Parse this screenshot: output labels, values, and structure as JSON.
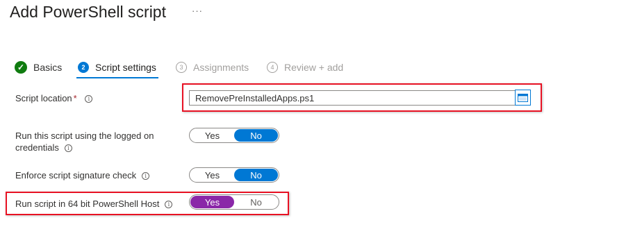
{
  "page": {
    "title": "Add PowerShell script",
    "more_label": "···"
  },
  "wizard": {
    "steps": [
      {
        "label": "Basics",
        "number": "✓",
        "state": "done"
      },
      {
        "label": "Script settings",
        "number": "2",
        "state": "active"
      },
      {
        "label": "Assignments",
        "number": "3",
        "state": "pending"
      },
      {
        "label": "Review + add",
        "number": "4",
        "state": "pending"
      }
    ]
  },
  "form": {
    "script_location": {
      "label": "Script location",
      "required_mark": "*",
      "value": "RemovePreInstalledApps.ps1"
    },
    "logged_on_credentials": {
      "label_line1": "Run this script using the logged on",
      "label_line2": "credentials",
      "yes": "Yes",
      "no": "No",
      "selected": "No"
    },
    "signature_check": {
      "label": "Enforce script signature check",
      "yes": "Yes",
      "no": "No",
      "selected": "No"
    },
    "run_64bit": {
      "label": "Run script in 64 bit PowerShell Host",
      "yes": "Yes",
      "no": "No",
      "selected": "Yes"
    }
  },
  "icons": {
    "info": "i",
    "folder": "folder-icon"
  },
  "colors": {
    "accent": "#0078d4",
    "success": "#107c10",
    "selected_purple": "#8a27a8",
    "highlight_red": "#e81123"
  }
}
